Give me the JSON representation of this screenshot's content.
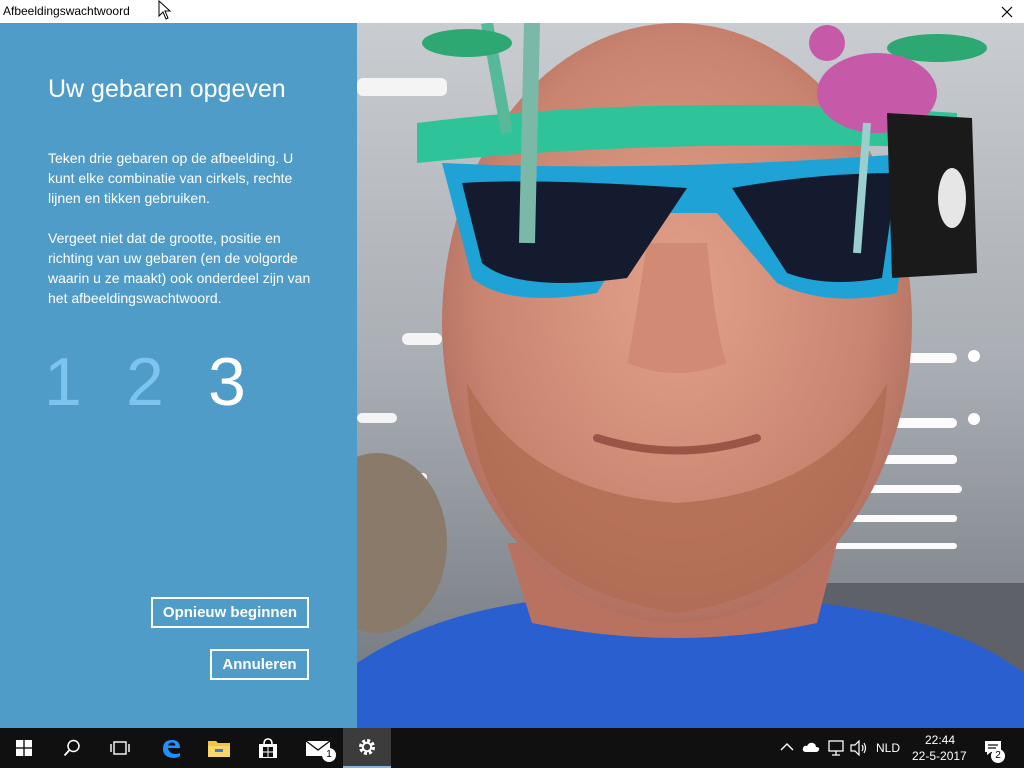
{
  "window": {
    "title": "Afbeeldingswachtwoord"
  },
  "panel": {
    "heading": "Uw gebaren opgeven",
    "paragraph1": "Teken drie gebaren op de afbeelding. U kunt elke combinatie van cirkels, rechte lijnen en tikken gebruiken.",
    "paragraph2": "Vergeet niet dat de grootte, positie en richting van uw gebaren (en de volgorde waarin u ze maakt) ook onderdeel zijn van het afbeeldingswachtwoord.",
    "steps": [
      "1",
      "2",
      "3"
    ],
    "current_step": 3,
    "restart_label": "Opnieuw beginnen",
    "cancel_label": "Annuleren"
  },
  "taskbar": {
    "icons": [
      "windows-start-icon",
      "search-icon",
      "task-view-icon",
      "edge-browser-icon",
      "file-explorer-icon",
      "store-icon",
      "mail-icon",
      "settings-icon"
    ],
    "mail_badge": "1",
    "language": "NLD",
    "time": "22:44",
    "date": "22-5-2017",
    "notification_count": "2"
  },
  "colors": {
    "panel_bg": "#4f9cc8",
    "step_done": "#7cc3ee",
    "step_current": "#ffffff",
    "taskbar_bg": "#101010"
  }
}
